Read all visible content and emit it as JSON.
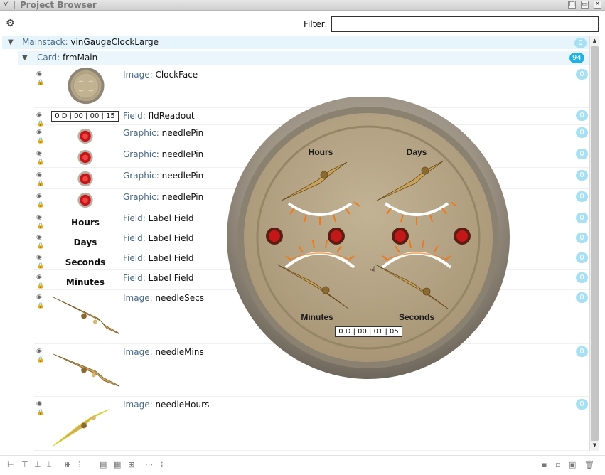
{
  "window": {
    "title": "Project Browser",
    "buttons": [
      "□",
      "▭",
      "✕"
    ]
  },
  "toolbar": {
    "filter_label": "Filter:",
    "filter_value": ""
  },
  "tree": {
    "mainstack": {
      "kind": "Mainstack:",
      "name": "vinGaugeClockLarge",
      "count": "0"
    },
    "card": {
      "kind": "Card:",
      "name": "frmMain",
      "count": "94"
    },
    "items": [
      {
        "kind": "Image:",
        "name": "ClockFace",
        "count": "0"
      },
      {
        "kind": "Field:",
        "name": "fldReadout",
        "count": "0",
        "thumb_text": "0 D | 00 | 00 | 15"
      },
      {
        "kind": "Graphic:",
        "name": "needlePin",
        "count": "0"
      },
      {
        "kind": "Graphic:",
        "name": "needlePin",
        "count": "0"
      },
      {
        "kind": "Graphic:",
        "name": "needlePin",
        "count": "0"
      },
      {
        "kind": "Graphic:",
        "name": "needlePin",
        "count": "0"
      },
      {
        "kind": "Field:",
        "name": "Label Field",
        "count": "0",
        "thumb_text": "Hours"
      },
      {
        "kind": "Field:",
        "name": "Label Field",
        "count": "0",
        "thumb_text": "Days"
      },
      {
        "kind": "Field:",
        "name": "Label Field",
        "count": "0",
        "thumb_text": "Seconds"
      },
      {
        "kind": "Field:",
        "name": "Label Field",
        "count": "0",
        "thumb_text": "Minutes"
      },
      {
        "kind": "Image:",
        "name": "needleSecs",
        "count": "0"
      },
      {
        "kind": "Image:",
        "name": "needleMins",
        "count": "0"
      },
      {
        "kind": "Image:",
        "name": "needleHours",
        "count": "0"
      }
    ]
  },
  "clock": {
    "labels": {
      "hours": "Hours",
      "days": "Days",
      "minutes": "Minutes",
      "seconds": "Seconds"
    },
    "readout": "0 D | 00 | 01 | 05"
  },
  "colors": {
    "accent": "#1fb2e6",
    "gauge_face": "#b09e7e",
    "gauge_rim": "#9a9183",
    "pin": "#cc2222",
    "tick_orange": "#f07818"
  }
}
